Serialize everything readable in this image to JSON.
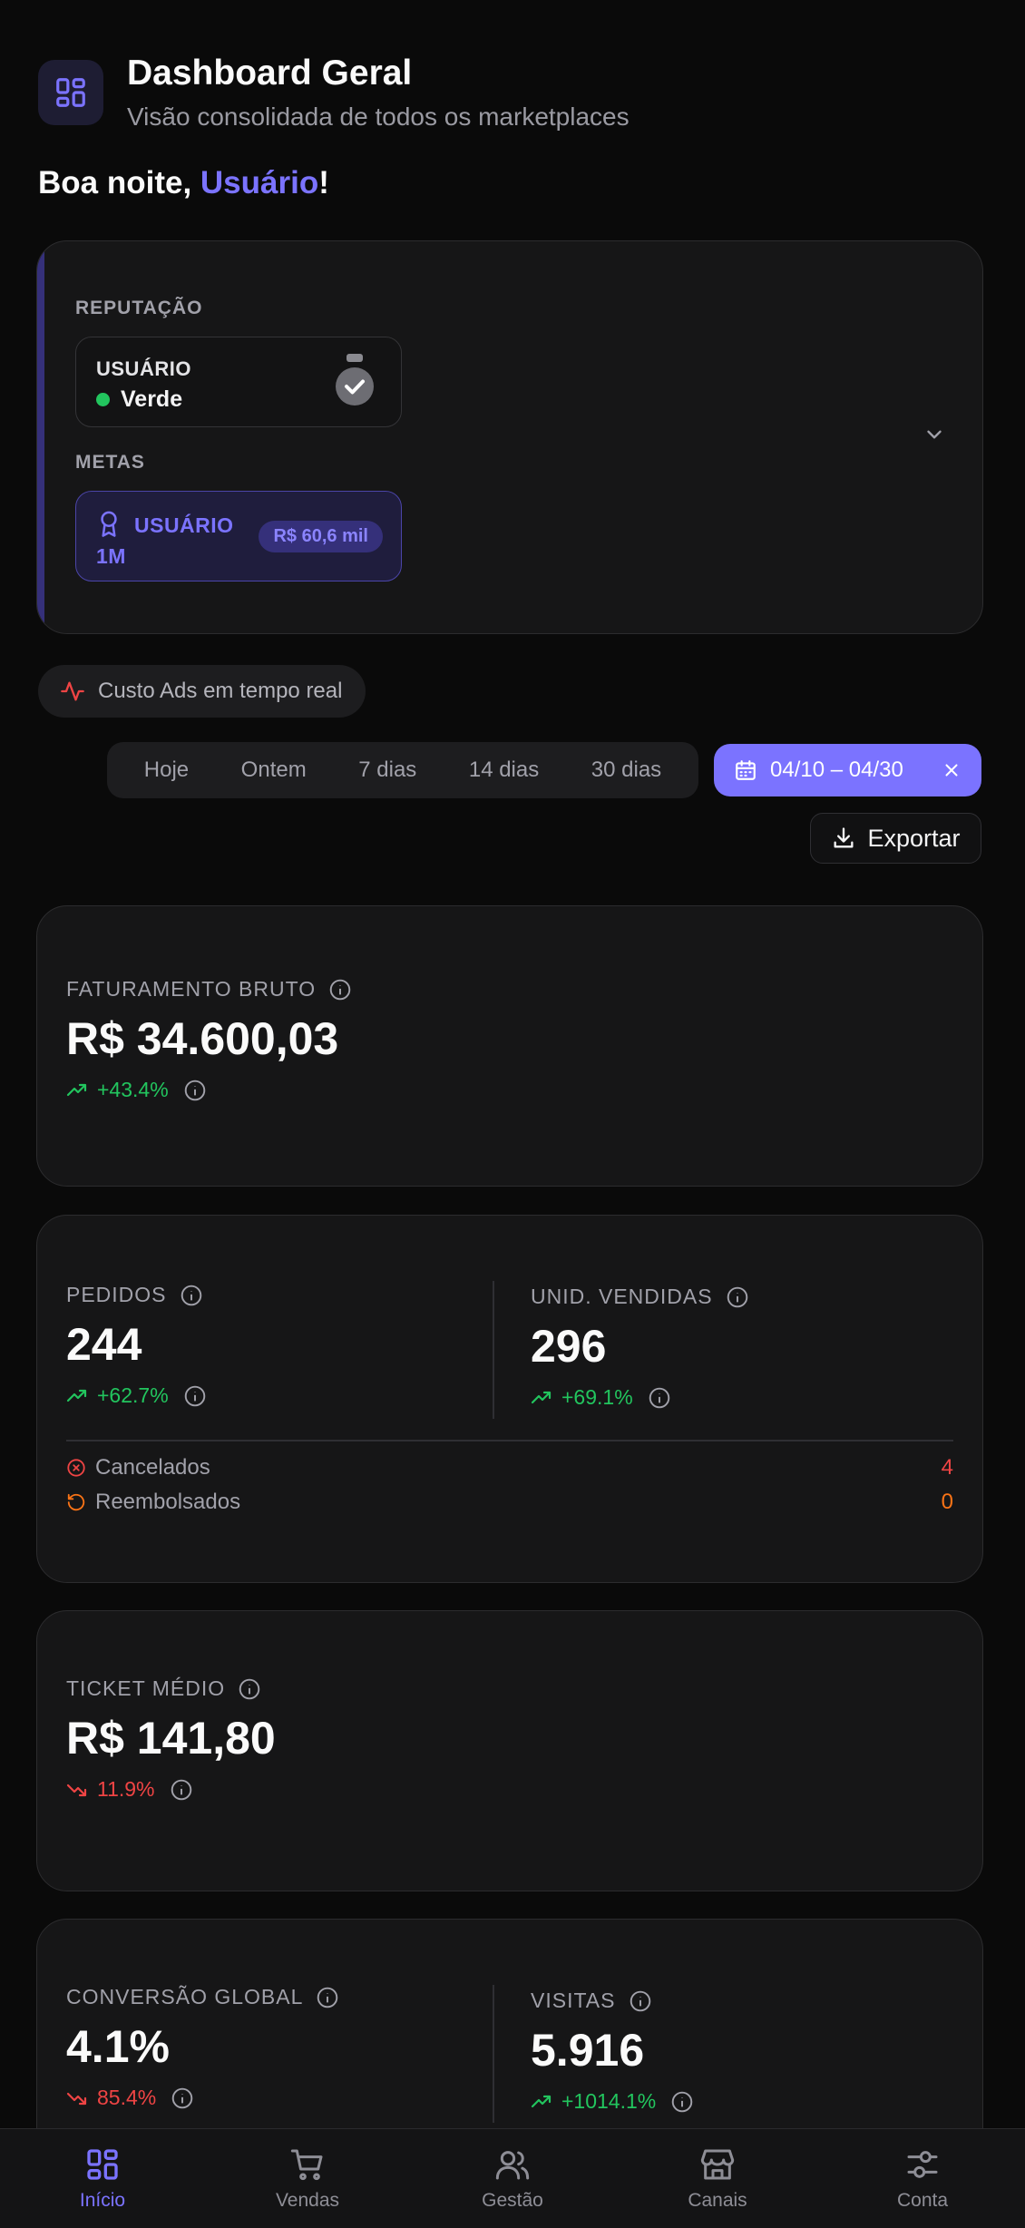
{
  "header": {
    "title": "Dashboard Geral",
    "subtitle": "Visão consolidada de todos os marketplaces"
  },
  "greeting": {
    "prefix": "Boa noite, ",
    "user": "Usuário",
    "suffix": "!"
  },
  "reputation": {
    "section_label": "REPUTAÇÃO",
    "name": "USUÁRIO",
    "status": "Verde",
    "status_color": "#22c55e"
  },
  "goals": {
    "section_label": "METAS",
    "name": "USUÁRIO 1M",
    "badge": "R$ 60,6 mil"
  },
  "ads_chip": {
    "label": "Custo Ads em tempo real"
  },
  "ranges": [
    "Hoje",
    "Ontem",
    "7 dias",
    "14 dias",
    "30 dias"
  ],
  "date_range": {
    "label": "04/10 – 04/30"
  },
  "export": {
    "label": "Exportar"
  },
  "metrics": {
    "revenue": {
      "label": "FATURAMENTO BRUTO",
      "value": "R$ 34.600,03",
      "delta": "+43.4%"
    },
    "orders": {
      "label": "PEDIDOS",
      "value": "244",
      "delta": "+62.7%"
    },
    "units": {
      "label": "UNID. VENDIDAS",
      "value": "296",
      "delta": "+69.1%"
    },
    "cancelled": {
      "label": "Cancelados",
      "count": "4"
    },
    "refunded": {
      "label": "Reembolsados",
      "count": "0"
    },
    "ticket": {
      "label": "TICKET MÉDIO",
      "value": "R$ 141,80",
      "delta": "11.9%"
    },
    "conversion": {
      "label": "CONVERSÃO GLOBAL",
      "value": "4.1%",
      "delta": "85.4%"
    },
    "visits": {
      "label": "VISITAS",
      "value": "5.916",
      "delta": "+1014.1%"
    }
  },
  "nav": {
    "home": "Início",
    "sales": "Vendas",
    "management": "Gestão",
    "channels": "Canais",
    "account": "Conta"
  },
  "colors": {
    "accent": "#7b73ff",
    "positive": "#22c55e",
    "negative": "#ef4444",
    "warning": "#f97316"
  }
}
